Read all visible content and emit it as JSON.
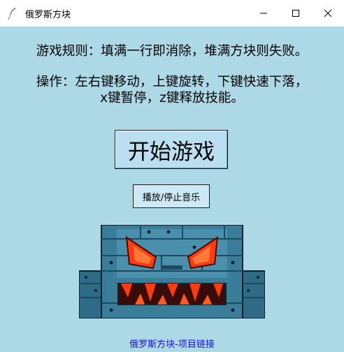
{
  "window": {
    "title": "俄罗斯方块",
    "icon": "feather-icon",
    "controls": [
      "minimize-icon",
      "maximize-icon",
      "close-icon"
    ]
  },
  "rules": {
    "line1": "游戏规则：填满一行即消除，堆满方块则失败。",
    "line2": "操作：左右键移动，上键旋转，下键快速下落，",
    "line3": "x键暂停，z键释放技能。"
  },
  "buttons": {
    "start": "开始游戏",
    "music": "播放/停止音乐"
  },
  "link": {
    "text": "俄罗斯方块-项目链接"
  },
  "colors": {
    "background": "#add8e6",
    "link": "#1010ee",
    "monster_body": "#2f6b86",
    "monster_eyes": "#ff3b10"
  }
}
